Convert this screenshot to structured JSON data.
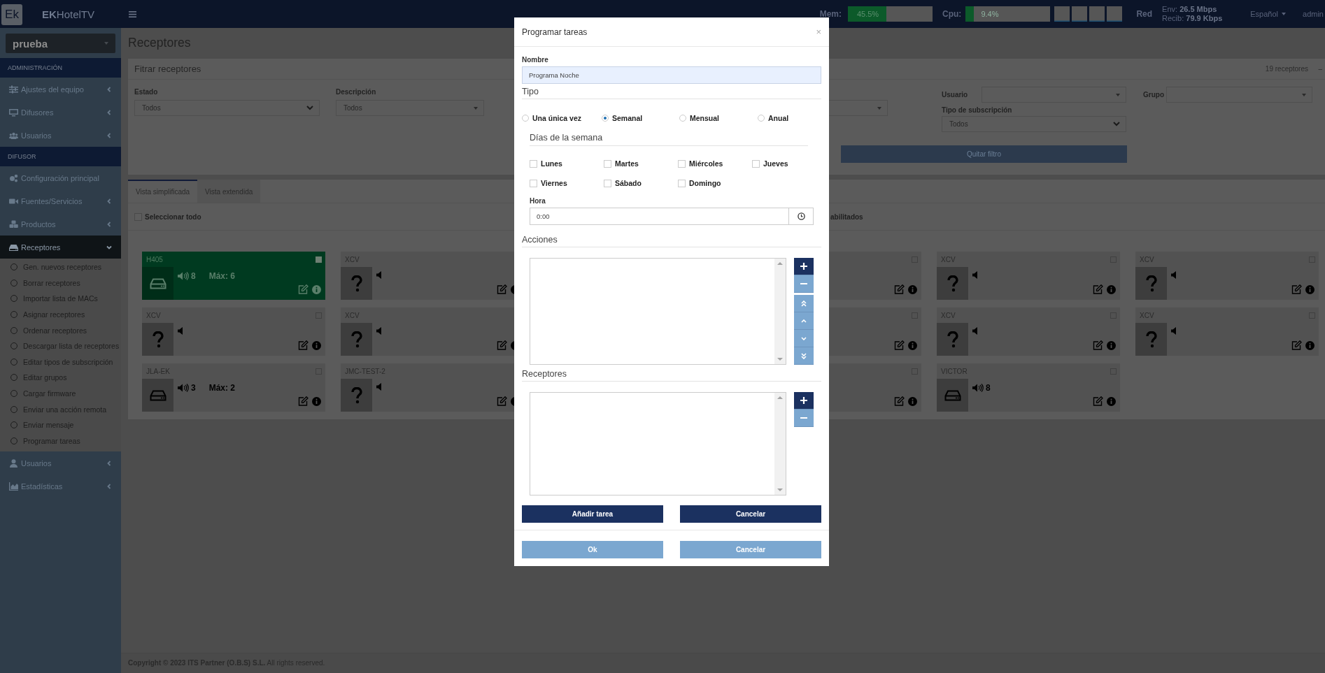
{
  "header": {
    "logo_mark": "Ek",
    "brand_bold": "EK",
    "brand_rest": "HotelTV",
    "mem_label": "Mem:",
    "mem": {
      "level": 0.455,
      "reading": "45.5%"
    },
    "cpu_label": "Cpu:",
    "cpu": {
      "level": 0.094,
      "reading": "9.4%"
    },
    "net_label": "Red",
    "env_label": "Env:",
    "env_value": "26.5 Mbps",
    "recib_label": "Recib:",
    "recib_value": "79.9 Kbps",
    "language": "Español",
    "user": "admin"
  },
  "sidebar": {
    "site": "prueba",
    "nav": [
      {
        "kind": "section",
        "label": "ADMINISTRACIÓN"
      },
      {
        "kind": "item",
        "label": "Ajustes del equipo",
        "expandable": true,
        "expanded": false,
        "selected": false
      },
      {
        "kind": "item",
        "label": "Difusores",
        "expandable": true,
        "expanded": false,
        "selected": false
      },
      {
        "kind": "item",
        "label": "Usuarios",
        "expandable": true,
        "expanded": false,
        "selected": false
      },
      {
        "kind": "section",
        "label": "DIFUSOR"
      },
      {
        "kind": "item",
        "label": "Configuración principal",
        "expandable": false,
        "selected": false
      },
      {
        "kind": "item",
        "label": "Fuentes/Servicios",
        "expandable": true,
        "expanded": false,
        "selected": false
      },
      {
        "kind": "item",
        "label": "Productos",
        "expandable": true,
        "expanded": false,
        "selected": false
      },
      {
        "kind": "item",
        "label": "Receptores",
        "expandable": true,
        "expanded": true,
        "selected": true,
        "children": [
          "Gen. nuevos receptores",
          "Borrar receptores",
          "Importar lista de MACs",
          "Asignar receptores",
          "Ordenar receptores",
          "Descargar lista de receptores",
          "Editar tipos de subscripción",
          "Editar grupos",
          "Cargar firmware",
          "Enviar una acción remota",
          "Enviar mensaje",
          "Programar tareas"
        ]
      },
      {
        "kind": "item",
        "label": "Usuarios",
        "expandable": true,
        "expanded": false,
        "selected": false
      },
      {
        "kind": "item",
        "label": "Estadísticas",
        "expandable": true,
        "expanded": false,
        "selected": false
      }
    ]
  },
  "page_title": "Receptores",
  "filter_panel": {
    "title": "Fitrar receptores",
    "count": "19 receptores",
    "collapse": "−",
    "filters": [
      {
        "kind": "native",
        "label": "Estado",
        "value": "Todos"
      },
      {
        "kind": "combo",
        "label": "Descripción",
        "value": "Todos"
      },
      {
        "kind": "combo"
      },
      {
        "kind": "combo",
        "label": "Usuario"
      },
      {
        "kind": "combo",
        "label": "Grupo"
      }
    ],
    "subscription": {
      "label": "Tipo de subscripción",
      "value": "Todos"
    },
    "clear_button": "Quitar filtro"
  },
  "tabs": [
    {
      "label": "Vista simplificada",
      "selected": true
    },
    {
      "label": "Vista extendida",
      "selected": false
    }
  ],
  "select_all": {
    "label": "Seleccionar todo",
    "checked": false
  },
  "disabled_toggle_label": "abilitados",
  "card_rows": [
    [
      {
        "title": "H405",
        "kind": "set_top_box",
        "volume": "8",
        "max": "Máx: 6",
        "selected": true,
        "checked": true
      },
      {
        "title": "XCV",
        "kind": "unknown",
        "selected": false
      },
      null,
      {
        "kind": "covered",
        "selected": false,
        "checked": false
      },
      {
        "title": "XCV",
        "kind": "unknown",
        "selected": false,
        "checked": false
      },
      {
        "title": "XCV",
        "kind": "unknown",
        "selected": false,
        "checked": false
      }
    ],
    [
      {
        "title": "XCV",
        "kind": "unknown",
        "selected": false,
        "checked": false
      },
      {
        "title": "XCV",
        "kind": "unknown",
        "selected": false
      },
      null,
      {
        "kind": "covered",
        "selected": false,
        "checked": false
      },
      {
        "title": "XCV",
        "kind": "unknown",
        "selected": false,
        "checked": false
      },
      {
        "title": "XCV",
        "kind": "unknown",
        "selected": false,
        "checked": false
      }
    ],
    [
      {
        "title": "JLA-EK",
        "kind": "set_top_box",
        "volume": "3",
        "max": "Máx: 2",
        "selected": false,
        "checked": false
      },
      {
        "title": "JMC-TEST-2",
        "kind": "unknown",
        "selected": false
      },
      null,
      {
        "kind": "covered",
        "selected": false,
        "checked": false
      },
      {
        "title": "VICTOR",
        "kind": "set_top_box",
        "volume": "8",
        "selected": false,
        "checked": false
      }
    ]
  ],
  "footer": {
    "text": "**Copyright © 2023 ITS Partner (O.B.S) S.L.** All rights reserved."
  },
  "dialog": {
    "title": "Programar tareas",
    "close": "×",
    "name_label": "Nombre",
    "name_value": "Programa Noche",
    "type_heading": "Tipo",
    "types": [
      {
        "label": "Una única vez",
        "selected": false
      },
      {
        "label": "Semanal",
        "selected": true
      },
      {
        "label": "Mensual",
        "selected": false
      },
      {
        "label": "Anual",
        "selected": false
      }
    ],
    "days_heading": "Días de la semana",
    "days": [
      {
        "label": "Lunes",
        "checked": false
      },
      {
        "label": "Martes",
        "checked": false
      },
      {
        "label": "Miércoles",
        "checked": false
      },
      {
        "label": "Jueves",
        "checked": false
      },
      {
        "label": "Viernes",
        "checked": false
      },
      {
        "label": "Sábado",
        "checked": false
      },
      {
        "label": "Domingo",
        "checked": false
      }
    ],
    "time_label": "Hora",
    "time_value": "0:00",
    "actions_heading": "Acciones",
    "receivers_heading": "Receptores",
    "add_task": "Añadir tarea",
    "cancel_task": "Cancelar",
    "ok": "Ok",
    "cancel": "Cancelar"
  }
}
